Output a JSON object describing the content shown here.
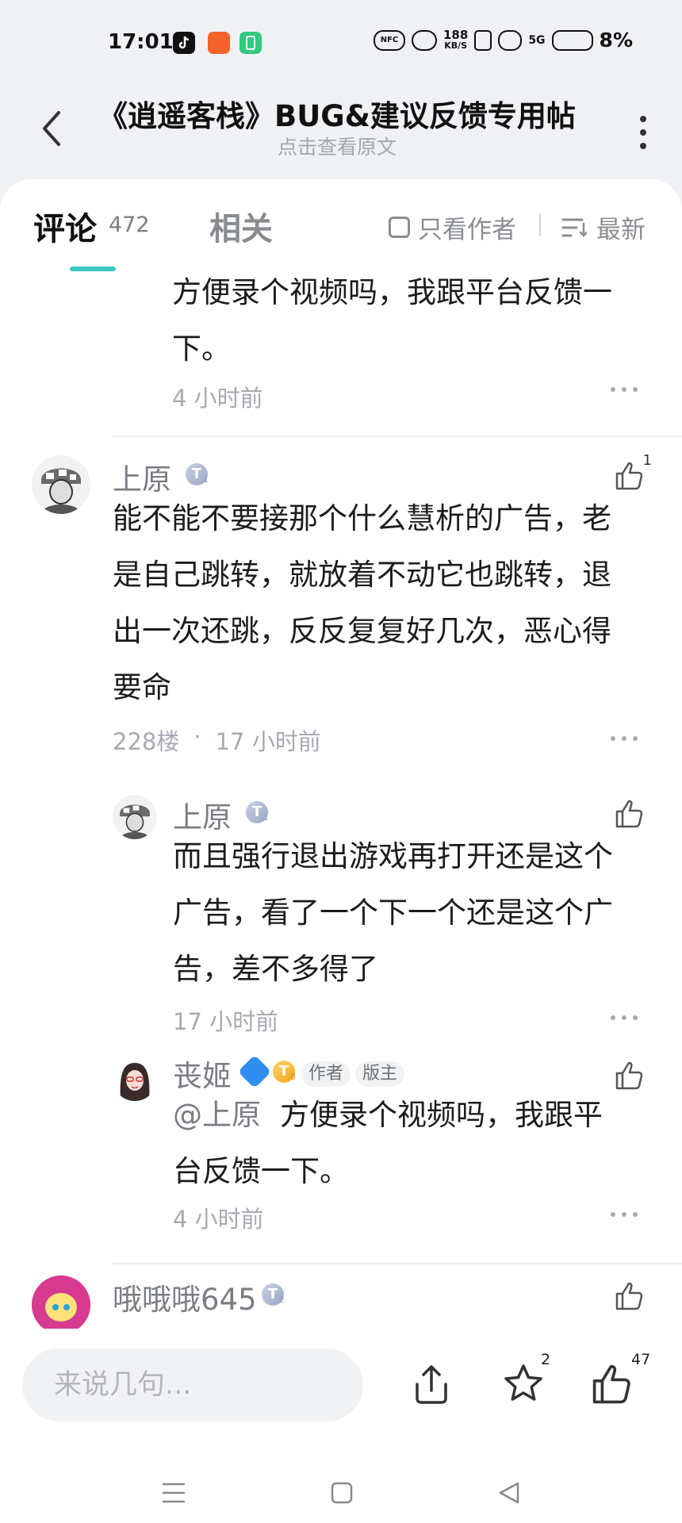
{
  "status_bar": {
    "time": "17:01",
    "net_speed": "188",
    "net_speed_unit": "KB/S",
    "net_type": "5G",
    "nfc": "NFC",
    "battery": "8%"
  },
  "header": {
    "title": "《逍遥客栈》BUG&建议反馈专用帖",
    "subtitle": "点击查看原文"
  },
  "tabs": {
    "comments_label": "评论",
    "comments_count": "472",
    "related_label": "相关",
    "author_only_label": "只看作者",
    "sort_label": "最新"
  },
  "comments": {
    "partial_reply": {
      "text_line1": "方便录个视频吗，我跟平台反馈一",
      "text_line2": "下。",
      "time": "4 小时前"
    },
    "main": {
      "user": "上原",
      "badge": "T",
      "badge_level": "1",
      "likes": "1",
      "text_lines": [
        "能不能不要接那个什么慧析的广告，老",
        "是自己跳转，就放着不动它也跳转，退",
        "出一次还跳，反反复复好几次，恶心得",
        "要命"
      ],
      "floor": "228楼",
      "dot": "·",
      "time": "17 小时前"
    },
    "reply1": {
      "user": "上原",
      "badge": "T",
      "badge_level": "1",
      "text_lines": [
        "而且强行退出游戏再打开还是这个",
        "广告，看了一个下一个还是这个广",
        "告，差不多得了"
      ],
      "time": "17 小时前"
    },
    "reply2": {
      "user": "丧姬",
      "badge": "T",
      "badge_level": "8",
      "tag_author": "作者",
      "tag_mod": "版主",
      "mention": "@上原",
      "text_line1": "方便录个视频吗，我跟平",
      "text_line2": "台反馈一下。",
      "time": "4 小时前"
    },
    "next": {
      "user": "哦哦哦645",
      "badge": "T",
      "badge_level": "2"
    }
  },
  "bottom_bar": {
    "input_placeholder": "来说几句...",
    "star_count": "2",
    "like_count": "47"
  },
  "colors": {
    "accent": "#3bc9c3",
    "background": "#eff1f5",
    "text_primary": "#1c1c1c",
    "text_secondary": "#a7aab0"
  }
}
